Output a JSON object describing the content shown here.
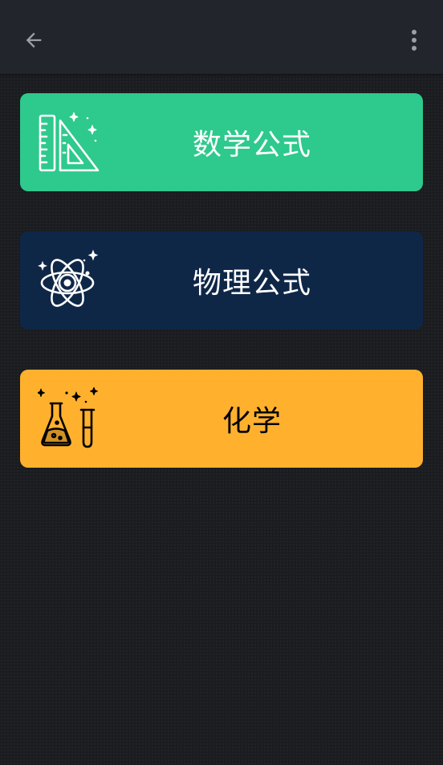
{
  "app_bar": {
    "back_icon": "arrow-left-icon",
    "menu_icon": "more-vertical-icon",
    "icon_color": "#9aa0a6"
  },
  "categories": [
    {
      "label": "数学公式",
      "icon": "ruler-triangle-icon",
      "background": "#2ec98c",
      "text_color": "#ffffff"
    },
    {
      "label": "物理公式",
      "icon": "atom-icon",
      "background": "#0f2747",
      "text_color": "#ffffff"
    },
    {
      "label": "化学",
      "icon": "flask-test-tube-icon",
      "background": "#ffb12e",
      "text_color": "#000000"
    }
  ]
}
